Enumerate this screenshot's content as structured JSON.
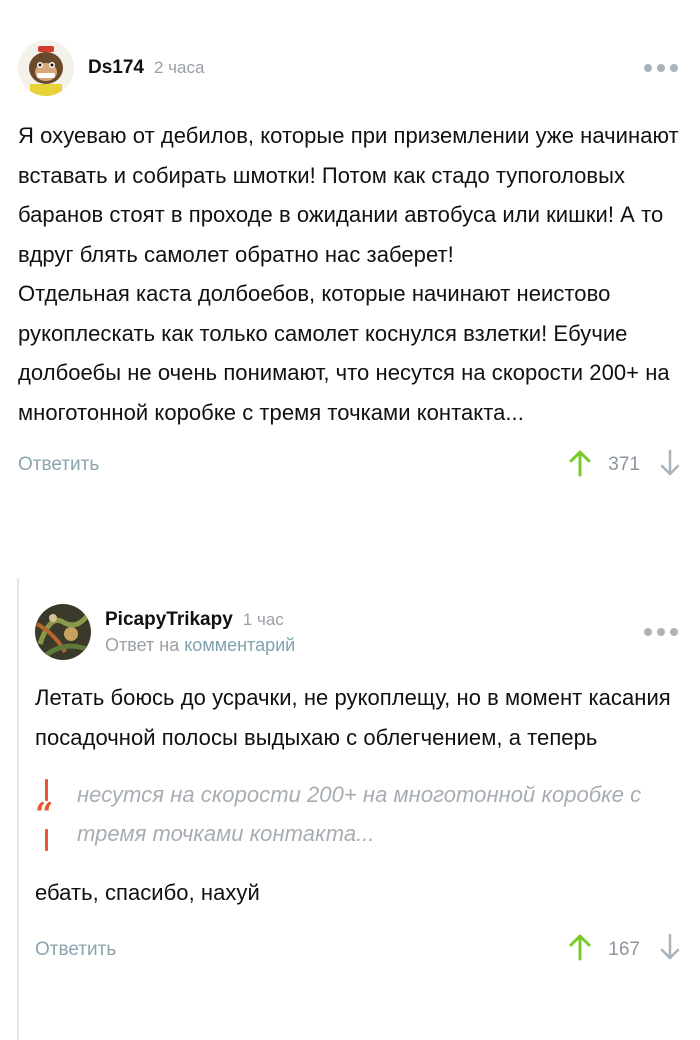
{
  "comments": [
    {
      "username": "Ds174",
      "time": "2 часа",
      "paragraphs": [
        "Я охуеваю от дебилов, которые при приземлении уже начинают вставать и собирать шмотки! Потом как стадо тупоголовых баранов стоят в проходе в ожидании автобуса или кишки! А то вдруг блять самолет обратно нас заберет!",
        "Отдельная каста долбоебов, которые начинают неистово рукоплескать как только самолет коснулся взлетки! Ебучие долбоебы не очень понимают, что несутся на скорости 200+ на многотонной коробке с тремя точками контакта..."
      ],
      "reply_label": "Ответить",
      "rating": "371"
    },
    {
      "username": "PicapyTrikapy",
      "time": "1 час",
      "reply_to_prefix": "Ответ на",
      "reply_to_link": "комментарий",
      "text_before_quote": "Летать боюсь до усрачки, не рукоплещу, но в момент касания посадочной полосы выдыхаю с облегчением, а теперь",
      "quote": "несутся на скорости 200+ на многотонной коробке с тремя точками контакта...",
      "text_after_quote": "ебать, спасибо, нахуй",
      "reply_label": "Ответить",
      "rating": "167"
    }
  ],
  "colors": {
    "accent_green": "#7ac92a",
    "reply_link": "#8aa5ae",
    "quote_bar": "#e8552f"
  },
  "icons": [
    "more-dots-icon",
    "upvote-arrow-icon",
    "downvote-arrow-icon",
    "quote-icon"
  ]
}
